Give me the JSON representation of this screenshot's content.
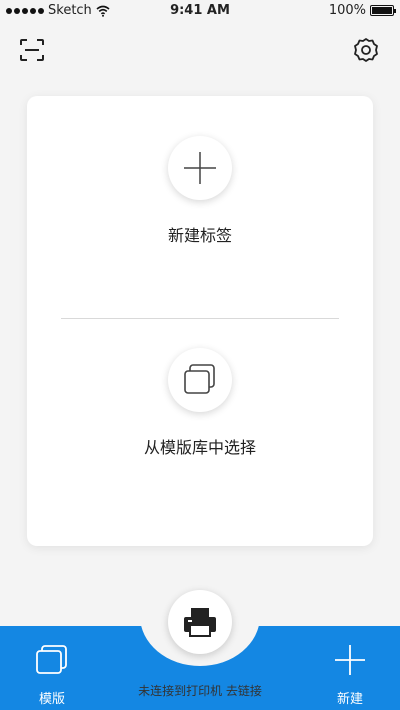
{
  "status_bar": {
    "carrier": "Sketch",
    "time": "9:41 AM",
    "battery_text": "100%",
    "battery_level": 1.0
  },
  "header": {
    "scan_icon": "scan-frame-icon",
    "settings_icon": "gear-icon"
  },
  "card": {
    "new_label": "新建标签",
    "new_icon": "plus-icon",
    "template_label": "从模版库中选择",
    "template_icon": "stacked-pages-icon"
  },
  "bottom_bar": {
    "color": "#1487e3",
    "template_tab_label": "模版",
    "template_tab_icon": "stacked-pages-icon",
    "new_tab_label": "新建",
    "new_tab_icon": "plus-icon",
    "print_icon": "printer-icon",
    "print_label": "未连接到打印机 去链接"
  }
}
